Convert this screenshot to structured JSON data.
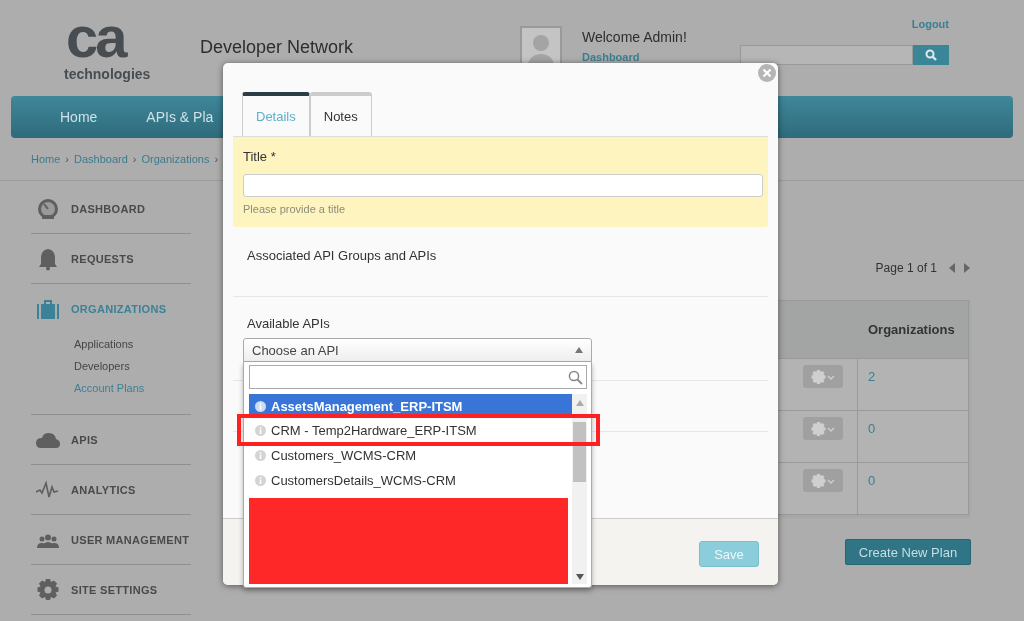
{
  "header": {
    "logo_mark": "ca",
    "logo_word": "technologies",
    "site_title": "Developer Network",
    "welcome": "Welcome Admin!",
    "dashboard_link": "Dashboard",
    "logout": "Logout"
  },
  "nav": [
    {
      "label": "Home"
    },
    {
      "label": "APIs & Pla"
    }
  ],
  "breadcrumb": {
    "items": [
      "Home",
      "Dashboard",
      "Organizations"
    ],
    "separator": "›"
  },
  "sidebar": [
    {
      "label": "DASHBOARD",
      "kind": "gauge",
      "selected": false
    },
    {
      "label": "REQUESTS",
      "kind": "bell",
      "selected": false
    },
    {
      "label": "ORGANIZATIONS",
      "kind": "briefcase",
      "selected": true,
      "children": [
        {
          "label": "Applications",
          "selected": false
        },
        {
          "label": "Developers",
          "selected": false
        },
        {
          "label": "Account Plans",
          "selected": true
        }
      ]
    },
    {
      "label": "APIS",
      "kind": "cloud",
      "selected": false
    },
    {
      "label": "ANALYTICS",
      "kind": "pulse",
      "selected": false
    },
    {
      "label": "USER MANAGEMENT",
      "kind": "people",
      "selected": false
    },
    {
      "label": "SITE SETTINGS",
      "kind": "gear",
      "selected": false
    }
  ],
  "pager": {
    "text": "Page 1 of 1"
  },
  "table": {
    "columns": [
      "Organizations"
    ],
    "rows": [
      {
        "organizations": "2"
      },
      {
        "organizations": "0"
      },
      {
        "organizations": "0"
      }
    ]
  },
  "create_button": "Create New Plan",
  "modal": {
    "tabs": [
      {
        "label": "Details",
        "selected": true
      },
      {
        "label": "Notes",
        "selected": false
      }
    ],
    "title_label": "Title *",
    "title_hint": "Please provide a title",
    "section_heading": "Associated API Groups and APIs",
    "available_label": "Available APIs",
    "select": {
      "value": "Choose an API",
      "expanded": true,
      "options": [
        {
          "label": "AssetsManagement_ERP-ITSM",
          "selected": true
        },
        {
          "label": "CRM - Temp2Hardware_ERP-ITSM",
          "selected": false
        },
        {
          "label": "Customers_WCMS-CRM",
          "selected": false
        },
        {
          "label": "CustomersDetails_WCMS-CRM",
          "selected": false
        }
      ]
    },
    "save": {
      "label": "Save",
      "disabled": true
    }
  }
}
